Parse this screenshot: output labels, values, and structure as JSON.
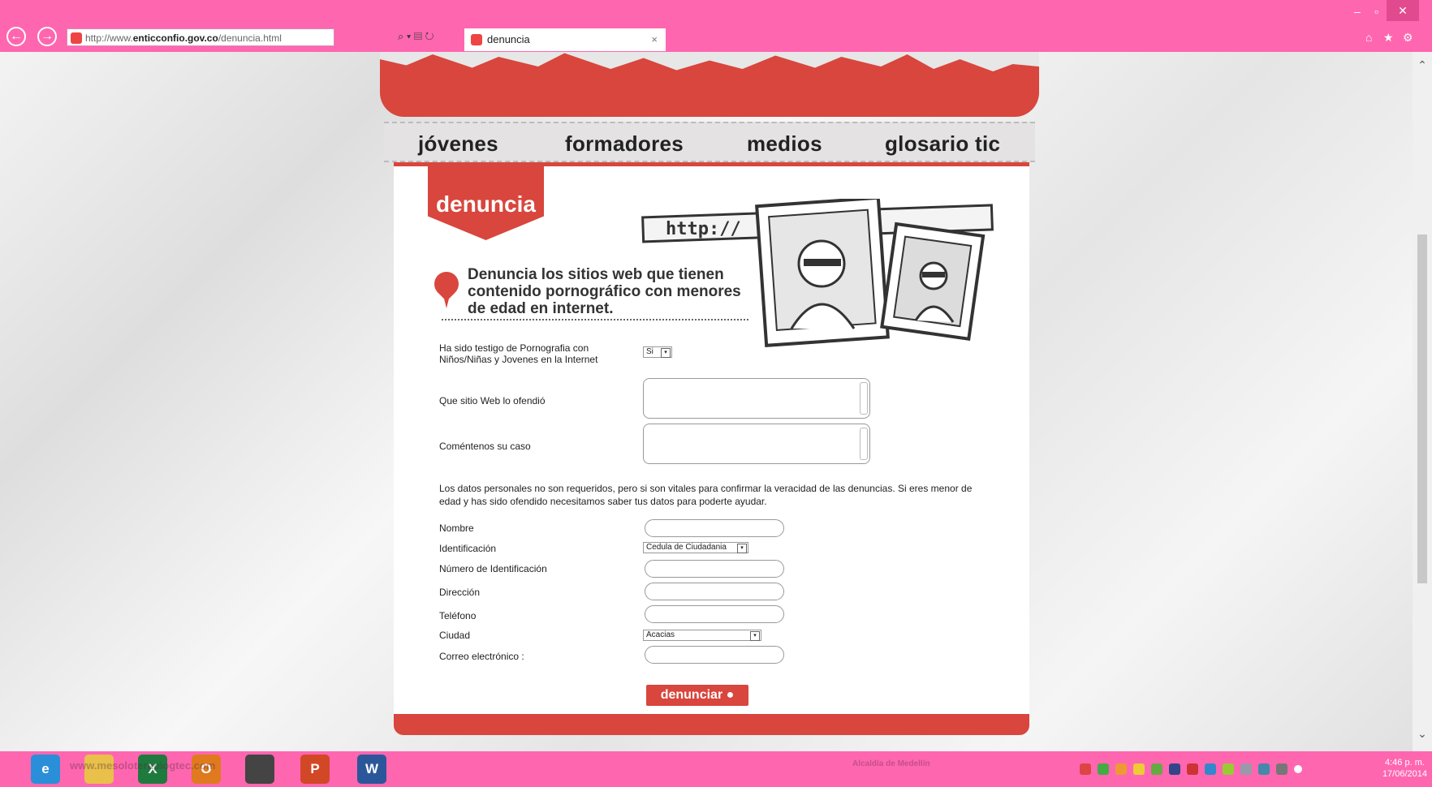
{
  "browser": {
    "url_prefix": "http://www.",
    "url_domain": "enticconfio.gov.co",
    "url_path": "/denuncia.html",
    "search_icon_text": "⌕ ▾ ▤ ↻",
    "tab_title": "denuncia",
    "tab_close": "×",
    "back": "←",
    "forward": "→",
    "minimize": "–",
    "restore": "▫",
    "close": "✕",
    "home_icon": "⌂",
    "star_icon": "★",
    "gear_icon": "⚙"
  },
  "site": {
    "nav": [
      "jóvenes",
      "formadores",
      "medios",
      "glosario tic"
    ],
    "section_title": "denuncia",
    "intro": "Denuncia los sitios web que tienen contenido pornográfico con menores de edad en internet.",
    "illustration_url_text": "http://"
  },
  "form": {
    "q_witness": "Ha sido testigo de Pornografia con Niños/Niñas y Jovenes en la Internet",
    "q_witness_value": "Si",
    "q_site": "Que sitio Web lo ofendió",
    "q_case": "Coméntenos su caso",
    "notice": "Los datos personales no son requeridos, pero si son vitales para confirmar la veracidad de las denuncias. Si eres menor de edad y has sido ofendido necesitamos saber tus datos para poderte ayudar.",
    "name_label": "Nombre",
    "id_label": "Identificación",
    "id_value": "Cedula de Ciudadania",
    "idnum_label": "Número de Identificación",
    "address_label": "Dirección",
    "phone_label": "Teléfono",
    "city_label": "Ciudad",
    "city_value": "Acacias",
    "email_label": "Correo electrónico :",
    "submit": "denunciar",
    "dropdown_arrow": "▾"
  },
  "taskbar": {
    "apps": [
      "e",
      "",
      "X",
      "O",
      "",
      "P",
      "W"
    ],
    "faint_left": "www.mesoloterapiogtec.com",
    "faint_items": [
      "Alcaldía de Medellín"
    ],
    "time": "4:46 p. m.",
    "date": "17/06/2014"
  },
  "colors": {
    "accent_pink": "#ff66b0",
    "brand_red": "#d8463d"
  }
}
